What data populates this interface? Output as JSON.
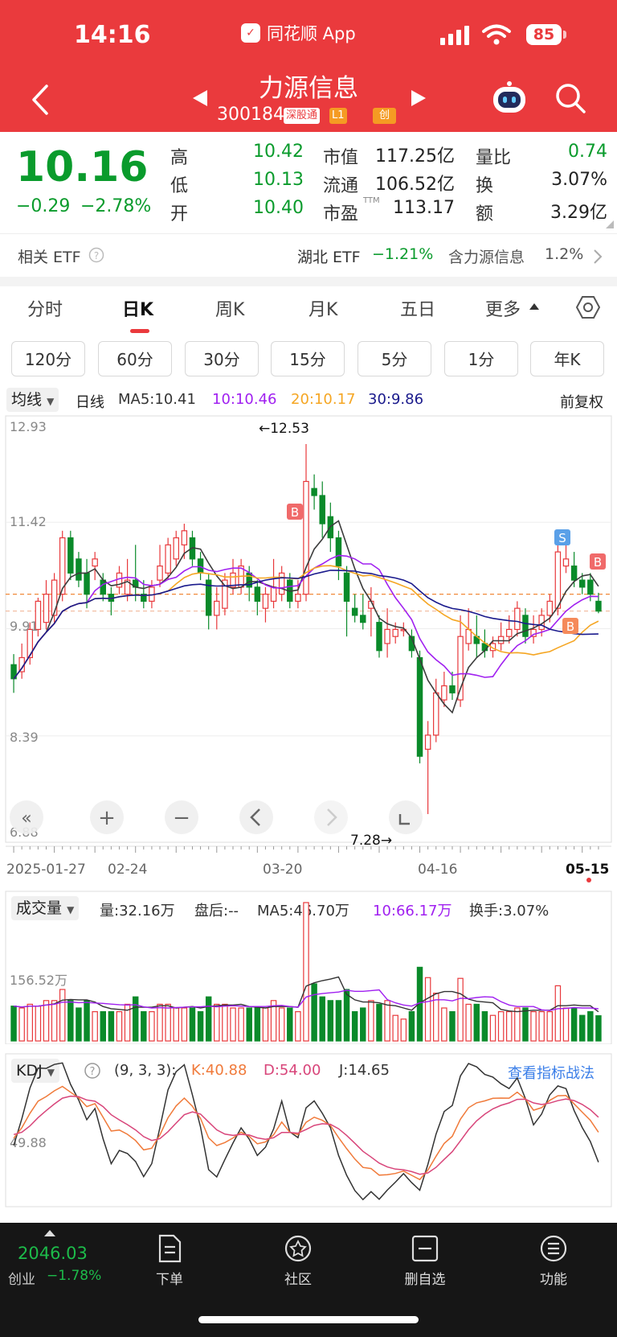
{
  "status": {
    "time": "14:16",
    "app": "同花顺 App",
    "battery": "85"
  },
  "header": {
    "name": "力源信息",
    "code": "300184",
    "tag_connect": "深股通",
    "tag_level": "L1",
    "tag_board": "创"
  },
  "quote": {
    "price": "10.16",
    "change": "−0.29",
    "change_pct": "−2.78%",
    "high_label": "高",
    "high": "10.42",
    "low_label": "低",
    "low": "10.13",
    "open_label": "开",
    "open": "10.40",
    "mcap_label": "市值",
    "mcap": "117.25亿",
    "float_label": "流通",
    "float": "106.52亿",
    "pe_label": "市盈",
    "pe_sup": "TTM",
    "pe": "113.17",
    "vr_label": "量比",
    "vr": "0.74",
    "turn_label": "换",
    "turn": "3.07%",
    "amt_label": "额",
    "amt": "3.29亿"
  },
  "etf": {
    "label": "相关 ETF",
    "name": "湖北 ETF",
    "chg": "−1.21%",
    "holding": "含力源信息",
    "weight": "1.2%"
  },
  "tabs": [
    "分时",
    "日K",
    "周K",
    "月K",
    "五日",
    "更多"
  ],
  "minute_buttons": [
    "120分",
    "60分",
    "30分",
    "15分",
    "5分",
    "1分",
    "年K"
  ],
  "ma_legend": {
    "type": "均线",
    "period": "日线",
    "ma5": "MA5:10.41",
    "ma10": "10:10.46",
    "ma20": "20:10.17",
    "ma30": "30:9.86",
    "adjust": "前复权"
  },
  "colors": {
    "red": "#e8383b",
    "green": "#0a8a2a",
    "ma5": "#3c3c3c",
    "ma10": "#a020f0",
    "ma20": "#f5a623",
    "ma30": "#1a1a8c"
  },
  "kline": {
    "y_labels": [
      "12.93",
      "11.42",
      "9.91",
      "8.39",
      "6.88"
    ],
    "max_label": "←12.53",
    "min_label": "7.28→",
    "dates": [
      "2025-01-27",
      "02-24",
      "03-20",
      "04-16",
      "05-15"
    ],
    "markers": [
      "B",
      "S",
      "B",
      "B"
    ]
  },
  "volume": {
    "type": "成交量",
    "vol": "量:32.16万",
    "after": "盘后:--",
    "ma5": "MA5:46.70万",
    "ma10": "10:66.17万",
    "turnover": "换手:3.07%",
    "y_label": "156.52万"
  },
  "kdj": {
    "type": "KDJ",
    "params": "(9, 3, 3):",
    "k": "K:40.88",
    "d": "D:54.00",
    "j": "J:14.65",
    "link": "查看指标战法",
    "y_label": "49.88"
  },
  "nav": {
    "index_value": "2046.03",
    "index_name": "创业",
    "index_chg": "−1.78%",
    "items": [
      "下单",
      "社区",
      "删自选",
      "功能"
    ]
  },
  "chart_data": {
    "type": "candlestick",
    "x_start": "2025-01-27",
    "x_end": "2025-05-15",
    "ylim": [
      6.88,
      12.93
    ],
    "max_price": 12.53,
    "min_price": 7.28,
    "candles": [
      [
        9.4,
        9.2,
        9.0,
        9.55
      ],
      [
        9.3,
        9.5,
        9.2,
        9.7
      ],
      [
        9.5,
        9.9,
        9.4,
        10.0
      ],
      [
        9.9,
        10.3,
        9.8,
        10.35
      ],
      [
        10.0,
        10.4,
        9.9,
        10.6
      ],
      [
        10.1,
        10.6,
        10.0,
        10.7
      ],
      [
        10.4,
        11.2,
        10.3,
        11.3
      ],
      [
        11.2,
        10.7,
        10.6,
        11.3
      ],
      [
        10.9,
        10.6,
        10.5,
        11.0
      ],
      [
        10.7,
        10.4,
        10.2,
        10.9
      ],
      [
        10.8,
        10.9,
        10.6,
        11.0
      ],
      [
        10.6,
        10.4,
        10.3,
        10.7
      ],
      [
        10.4,
        10.3,
        10.1,
        10.5
      ],
      [
        10.5,
        10.7,
        10.4,
        10.8
      ],
      [
        10.4,
        10.6,
        10.3,
        10.9
      ],
      [
        10.6,
        10.5,
        10.3,
        11.1
      ],
      [
        10.4,
        10.3,
        10.2,
        10.6
      ],
      [
        10.3,
        10.5,
        10.2,
        10.6
      ],
      [
        10.6,
        10.8,
        10.5,
        11.1
      ],
      [
        10.7,
        11.1,
        10.6,
        11.2
      ],
      [
        10.9,
        11.2,
        10.8,
        11.3
      ],
      [
        11.1,
        11.3,
        10.9,
        11.4
      ],
      [
        11.2,
        10.9,
        10.8,
        11.3
      ],
      [
        10.9,
        10.7,
        10.6,
        11.0
      ],
      [
        10.6,
        10.1,
        9.9,
        10.7
      ],
      [
        10.1,
        10.3,
        9.9,
        10.5
      ],
      [
        10.2,
        10.6,
        10.1,
        10.7
      ],
      [
        10.5,
        10.7,
        10.4,
        10.9
      ],
      [
        10.5,
        10.8,
        10.4,
        10.9
      ],
      [
        10.7,
        10.5,
        10.3,
        10.8
      ],
      [
        10.5,
        10.3,
        10.1,
        10.6
      ],
      [
        10.2,
        10.4,
        10.0,
        10.5
      ],
      [
        10.3,
        10.5,
        10.2,
        10.9
      ],
      [
        10.4,
        10.7,
        10.3,
        10.8
      ],
      [
        10.6,
        10.3,
        10.2,
        10.7
      ],
      [
        10.3,
        10.4,
        10.2,
        10.6
      ],
      [
        10.4,
        12.0,
        10.3,
        12.53
      ],
      [
        11.9,
        11.8,
        11.6,
        12.1
      ],
      [
        11.8,
        11.4,
        11.2,
        12.0
      ],
      [
        11.5,
        11.2,
        11.0,
        11.7
      ],
      [
        11.2,
        10.8,
        10.6,
        11.3
      ],
      [
        10.7,
        10.3,
        9.8,
        10.8
      ],
      [
        10.2,
        10.1,
        10.0,
        10.4
      ],
      [
        10.1,
        10.0,
        9.9,
        10.4
      ],
      [
        10.2,
        10.3,
        9.8,
        10.5
      ],
      [
        10.0,
        9.6,
        9.5,
        10.1
      ],
      [
        9.7,
        9.9,
        9.5,
        10.2
      ],
      [
        9.8,
        9.9,
        9.7,
        10.0
      ],
      [
        9.9,
        9.9,
        9.8,
        10.0
      ],
      [
        9.8,
        9.6,
        9.5,
        9.9
      ],
      [
        9.5,
        8.1,
        8.0,
        9.6
      ],
      [
        8.2,
        8.4,
        7.28,
        8.6
      ],
      [
        8.4,
        9.0,
        8.3,
        9.2
      ],
      [
        8.9,
        9.1,
        8.8,
        9.3
      ],
      [
        9.1,
        9.0,
        8.9,
        9.3
      ],
      [
        8.9,
        9.8,
        8.8,
        10.1
      ],
      [
        9.7,
        9.9,
        9.6,
        10.2
      ],
      [
        9.8,
        9.7,
        9.5,
        10.1
      ],
      [
        9.7,
        9.6,
        9.5,
        9.9
      ],
      [
        9.6,
        9.7,
        9.5,
        9.8
      ],
      [
        9.7,
        9.8,
        9.6,
        10.0
      ],
      [
        9.8,
        9.9,
        9.7,
        10.1
      ],
      [
        9.9,
        10.2,
        9.8,
        10.3
      ],
      [
        10.1,
        9.8,
        9.7,
        10.2
      ],
      [
        9.8,
        9.9,
        9.7,
        10.1
      ],
      [
        9.9,
        10.1,
        9.8,
        10.2
      ],
      [
        10.1,
        10.3,
        10.0,
        10.4
      ],
      [
        10.2,
        11.0,
        10.1,
        11.2
      ],
      [
        10.8,
        10.9,
        10.7,
        11.2
      ],
      [
        10.8,
        10.6,
        10.5,
        11.0
      ],
      [
        10.6,
        10.5,
        10.4,
        10.7
      ],
      [
        10.6,
        10.4,
        10.3,
        10.7
      ],
      [
        10.3,
        10.16,
        10.13,
        10.42
      ]
    ],
    "candle_format": [
      "open",
      "close",
      "low",
      "high"
    ],
    "ma5_last": 10.41,
    "ma10_last": 10.46,
    "ma20_last": 10.17,
    "ma30_last": 9.86
  }
}
